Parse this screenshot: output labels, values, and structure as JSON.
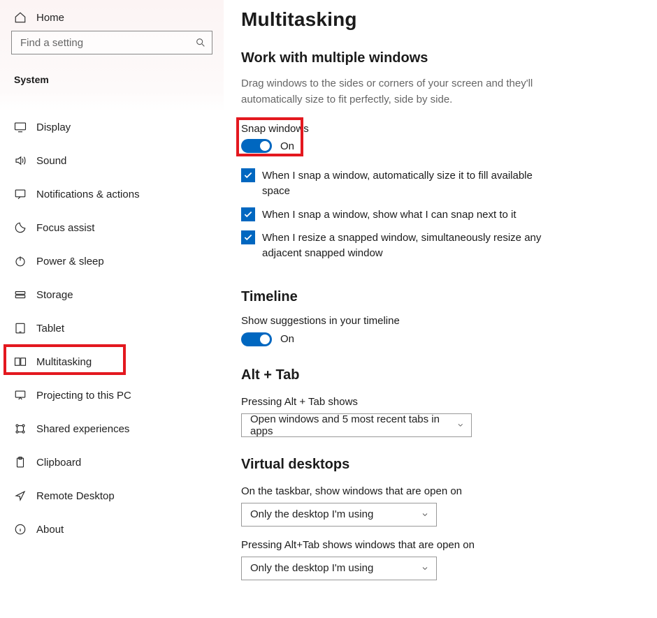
{
  "sidebar": {
    "home_label": "Home",
    "search_placeholder": "Find a setting",
    "category": "System",
    "items": [
      {
        "icon": "display",
        "label": "Display"
      },
      {
        "icon": "sound",
        "label": "Sound"
      },
      {
        "icon": "notify",
        "label": "Notifications & actions"
      },
      {
        "icon": "focus",
        "label": "Focus assist"
      },
      {
        "icon": "power",
        "label": "Power & sleep"
      },
      {
        "icon": "storage",
        "label": "Storage"
      },
      {
        "icon": "tablet",
        "label": "Tablet"
      },
      {
        "icon": "multitask",
        "label": "Multitasking",
        "selected": true
      },
      {
        "icon": "project",
        "label": "Projecting to this PC"
      },
      {
        "icon": "shared",
        "label": "Shared experiences"
      },
      {
        "icon": "clipboard",
        "label": "Clipboard"
      },
      {
        "icon": "remote",
        "label": "Remote Desktop"
      },
      {
        "icon": "about",
        "label": "About"
      }
    ]
  },
  "page": {
    "title": "Multitasking",
    "sections": {
      "snap": {
        "heading": "Work with multiple windows",
        "description": "Drag windows to the sides or corners of your screen and they'll automatically size to fit perfectly, side by side.",
        "toggle_label": "Snap windows",
        "toggle_value": "On",
        "checks": [
          "When I snap a window, automatically size it to fill available space",
          "When I snap a window, show what I can snap next to it",
          "When I resize a snapped window, simultaneously resize any adjacent snapped window"
        ]
      },
      "timeline": {
        "heading": "Timeline",
        "label": "Show suggestions in your timeline",
        "toggle_value": "On"
      },
      "alttab": {
        "heading": "Alt + Tab",
        "label": "Pressing Alt + Tab shows",
        "value": "Open windows and 5 most recent tabs in apps"
      },
      "vdesk": {
        "heading": "Virtual desktops",
        "taskbar_label": "On the taskbar, show windows that are open on",
        "taskbar_value": "Only the desktop I'm using",
        "alttab_label": "Pressing Alt+Tab shows windows that are open on",
        "alttab_value": "Only the desktop I'm using"
      }
    }
  }
}
